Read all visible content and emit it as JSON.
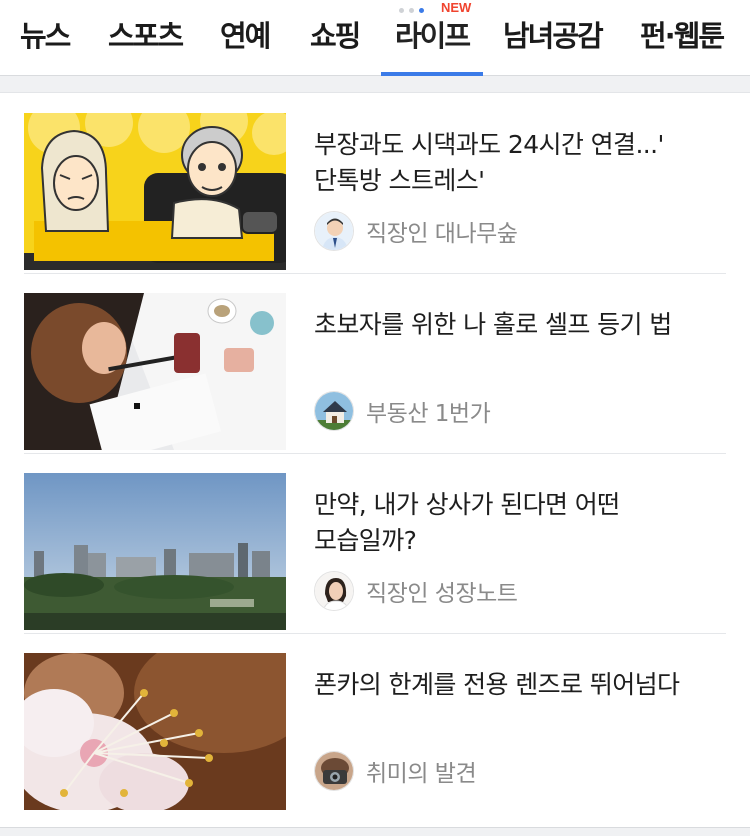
{
  "nav": {
    "tabs": [
      {
        "label": "뉴스"
      },
      {
        "label": "스포츠"
      },
      {
        "label": "연예"
      },
      {
        "label": "쇼핑"
      },
      {
        "label": "라이프",
        "badge": "NEW",
        "active": true
      },
      {
        "label": "남녀공감"
      },
      {
        "label": "펀·웹툰"
      }
    ],
    "accent_color": "#3b7be8",
    "badge_color": "#f0442f"
  },
  "feed": {
    "items": [
      {
        "title": "부장과도 시댁과도 24시간 연결...' 단톡방 스트레스'",
        "source": "직장인 대나무숲",
        "thumb": "cartoon-couple-with-phone",
        "avatar": "office-man-avatar"
      },
      {
        "title": "초보자를 위한 나 홀로 셀프 등기 법",
        "source": "부동산 1번가",
        "thumb": "woman-writing-at-desk",
        "avatar": "house-avatar"
      },
      {
        "title": "만약, 내가 상사가 된다면 어떤 모습일까?",
        "source": "직장인 성장노트",
        "thumb": "city-skyline",
        "avatar": "woman-avatar"
      },
      {
        "title": "폰카의 한계를 전용 렌즈로 뛰어넘다",
        "source": "취미의 발견",
        "thumb": "blossom-macro",
        "avatar": "camera-avatar"
      }
    ]
  }
}
